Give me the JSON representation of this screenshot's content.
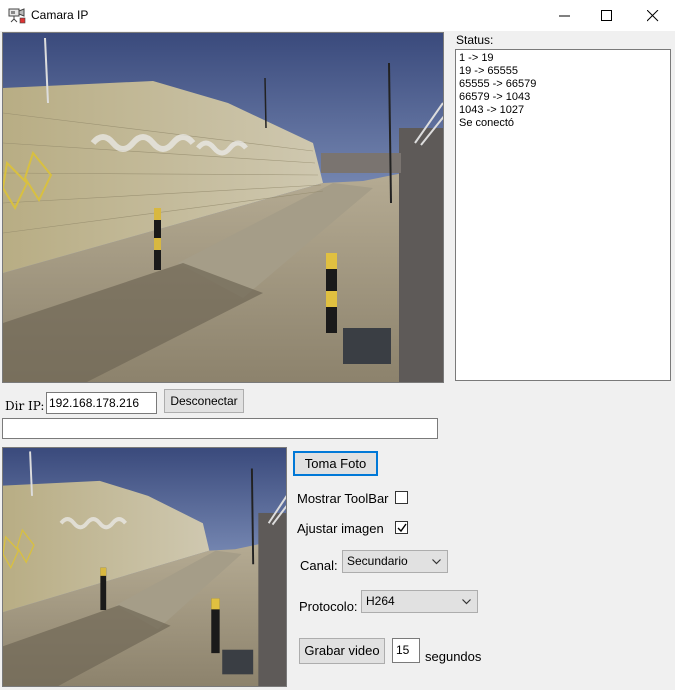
{
  "window": {
    "title": "Camara IP"
  },
  "status": {
    "label": "Status:",
    "lines": [
      "1 -> 19",
      "19 -> 65555",
      "65555 -> 66579",
      "66579 -> 1043",
      "1043 -> 1027",
      "Se conectó"
    ]
  },
  "connection": {
    "ip_label": "Dir IP:",
    "ip_value": "192.168.178.216",
    "disconnect_label": "Desconectar",
    "url_value": ""
  },
  "controls": {
    "photo_label": "Toma Foto",
    "toolbar_label": "Mostrar ToolBar",
    "toolbar_checked": false,
    "fit_label": "Ajustar imagen",
    "fit_checked": true,
    "channel_label": "Canal:",
    "channel_value": "Secundario",
    "protocol_label": "Protocolo:",
    "protocol_value": "H264",
    "record_label": "Grabar video",
    "record_seconds": "15",
    "seconds_label": "segundos"
  }
}
